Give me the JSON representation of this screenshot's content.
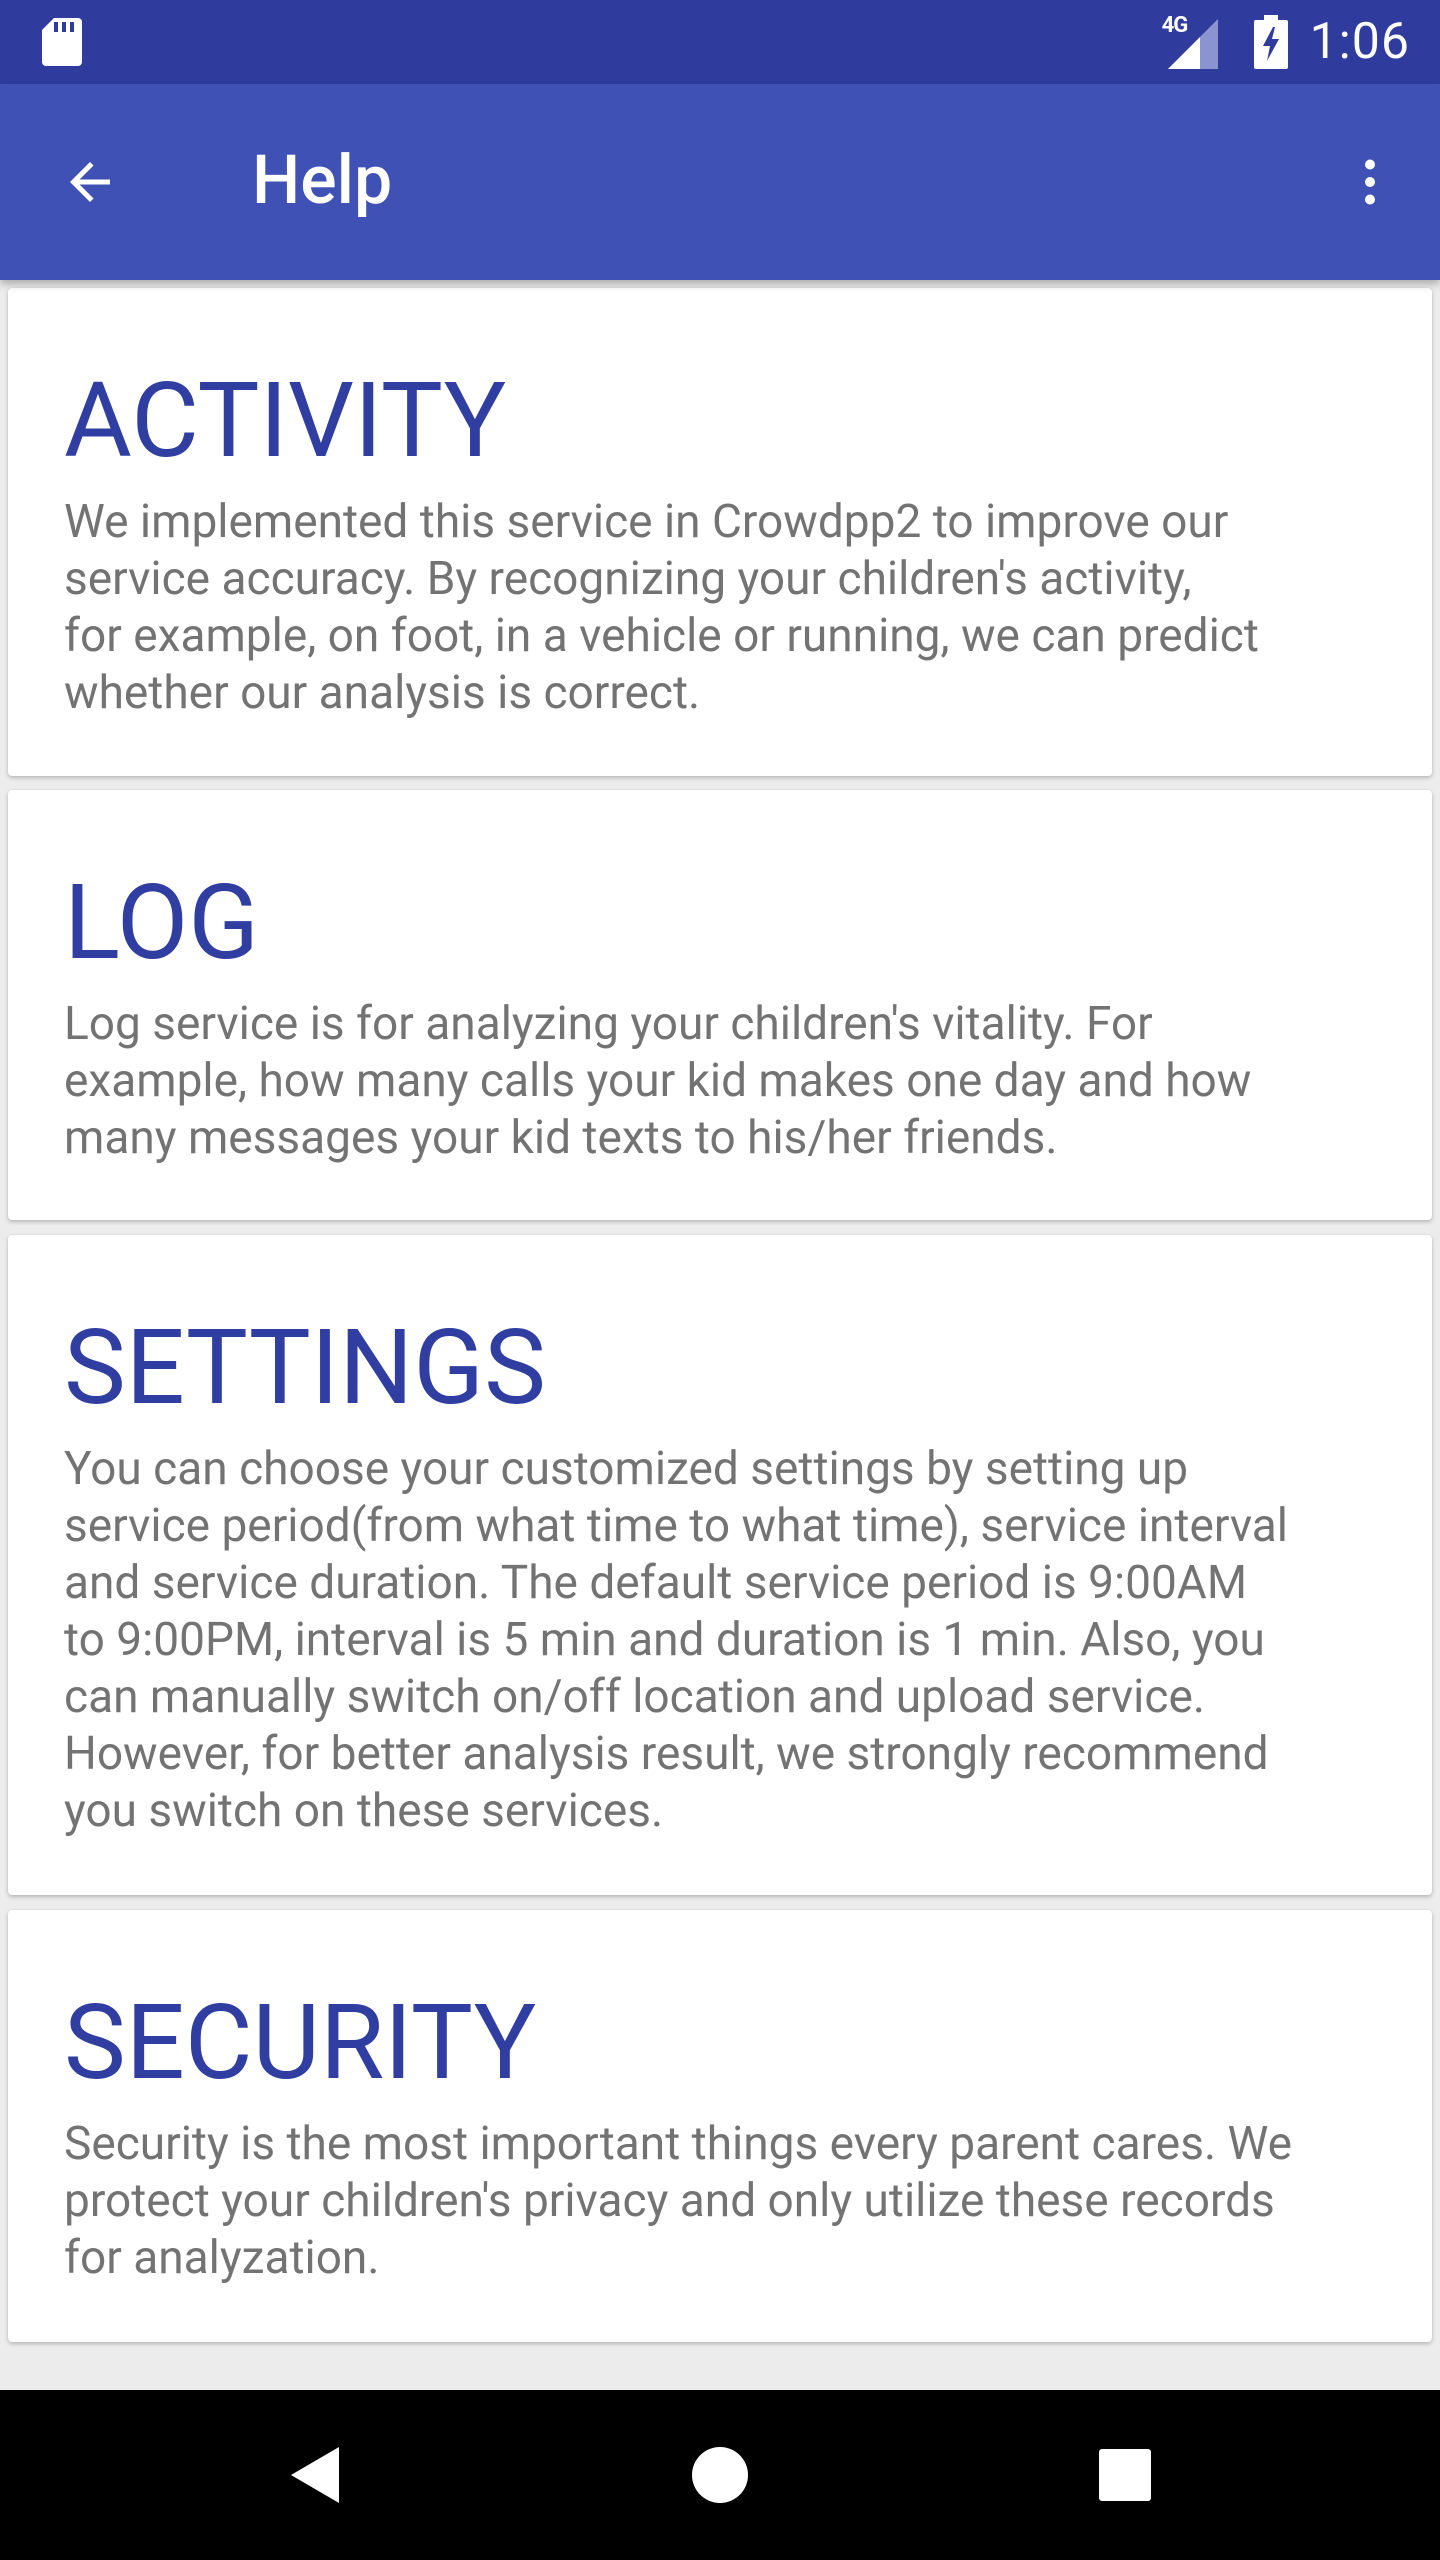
{
  "status_bar": {
    "network_label": "4G",
    "time": "1:06"
  },
  "app_bar": {
    "title": "Help"
  },
  "sections": [
    {
      "title": "ACTIVITY",
      "body": "We implemented this service in Crowdpp2 to improve our\nservice accuracy. By recognizing your children's activity,\nfor example, on foot, in a vehicle or running, we can predict\nwhether our analysis is correct."
    },
    {
      "title": "LOG",
      "body": "Log service is for analyzing your children's vitality. For\nexample, how many calls your kid makes one day and how\nmany messages your kid texts to his/her friends."
    },
    {
      "title": "SETTINGS",
      "body": "You can choose your customized settings by setting up\nservice period(from what time to what time), service interval\nand service duration. The default service period is 9:00AM\nto 9:00PM, interval is 5 min and duration is 1 min. Also, you\ncan manually switch on/off location and upload service.\nHowever, for better analysis result, we strongly recommend\nyou switch on these services."
    },
    {
      "title": "SECURITY",
      "body": "Security is the most important things every parent cares. We\nprotect your children's privacy and only utilize these records\nfor analyzation."
    }
  ],
  "colors": {
    "status_bar": "#2f3c9e",
    "app_bar": "#3f51b5",
    "section_title": "#2f3ea0",
    "body_text": "#737373",
    "background": "#ececec"
  },
  "icons": {
    "status_left": "sd-card-icon",
    "signal": "signal-icon",
    "battery": "battery-charging-icon",
    "back": "arrow-back-icon",
    "overflow": "more-vert-icon",
    "nav_back": "triangle-back-icon",
    "nav_home": "circle-home-icon",
    "nav_recents": "square-recents-icon"
  }
}
